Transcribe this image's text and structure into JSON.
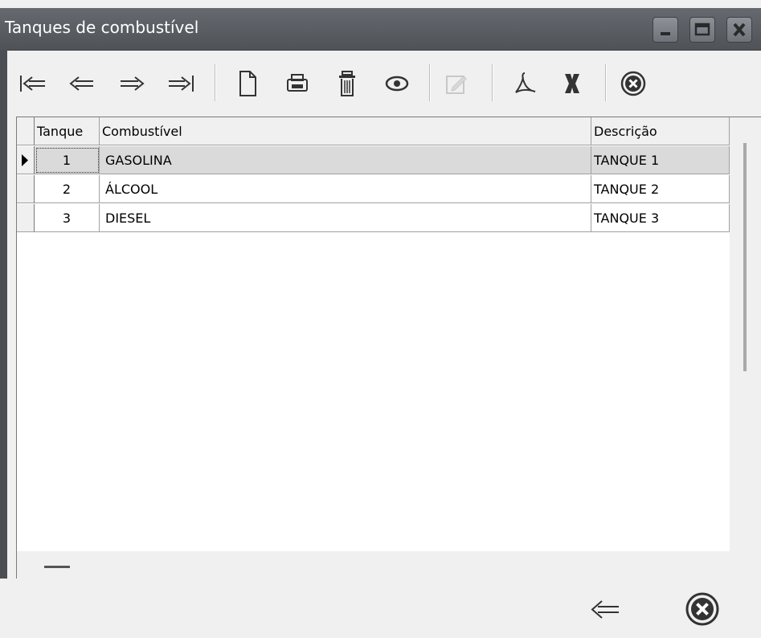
{
  "window": {
    "title": "Tanques de combustível",
    "titlebar_color": "#5a5e63"
  },
  "grid": {
    "columns": [
      "Tanque",
      "Combustível",
      "Descrição"
    ],
    "rows": [
      {
        "tanque": "1",
        "combustivel": "GASOLINA",
        "descricao": "TANQUE 1"
      },
      {
        "tanque": "2",
        "combustivel": "ÁLCOOL",
        "descricao": "TANQUE 2"
      },
      {
        "tanque": "3",
        "combustivel": "DIESEL",
        "descricao": "TANQUE 3"
      }
    ],
    "selected_row_index": 0
  },
  "icons": {
    "window_buttons": [
      "minimize-icon",
      "maximize-icon",
      "close-icon"
    ],
    "toolbar": [
      "first-record-icon",
      "previous-record-icon",
      "next-record-icon",
      "last-record-icon",
      "new-document-icon",
      "print-icon",
      "delete-icon",
      "view-icon",
      "edit-icon",
      "pdf-icon",
      "excel-icon",
      "cancel-icon"
    ],
    "bottom": [
      "back-icon",
      "close-circle-icon"
    ]
  }
}
